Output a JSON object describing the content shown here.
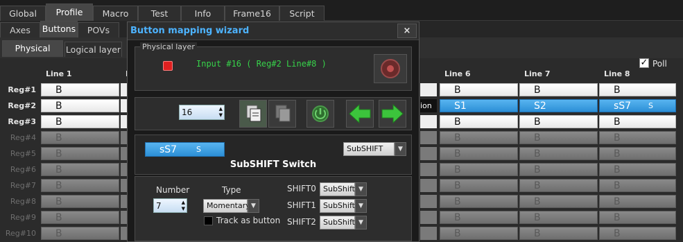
{
  "tabs": [
    "Global",
    "Profile",
    "Macro",
    "Test",
    "Info",
    "Frame16",
    "Script"
  ],
  "subtabs": [
    "Axes",
    "Buttons",
    "POVs"
  ],
  "layer_tabs": [
    "Physical layer",
    "Logical layer"
  ],
  "poll": {
    "label": "Poll",
    "checked": true,
    "checkmark": "✓"
  },
  "grid": {
    "columns": [
      "Line 1",
      "Line 6",
      "Line 7",
      "Line 8"
    ],
    "partial_col": "L",
    "rows": [
      "Reg#1",
      "Reg#2",
      "Reg#3",
      "Reg#4",
      "Reg#5",
      "Reg#6",
      "Reg#7",
      "Reg#8",
      "Reg#9",
      "Reg#10"
    ],
    "cells": [
      [
        "B",
        "B",
        "B",
        "B"
      ],
      [
        "B",
        "S1",
        "S2",
        "sS7"
      ],
      [
        "B",
        "B",
        "B",
        "B"
      ],
      [
        "B",
        "B",
        "B",
        "B"
      ],
      [
        "B",
        "B",
        "B",
        "B"
      ],
      [
        "B",
        "B",
        "B",
        "B"
      ],
      [
        "B",
        "B",
        "B",
        "B"
      ],
      [
        "B",
        "B",
        "B",
        "B"
      ],
      [
        "B",
        "B",
        "B",
        "B"
      ],
      [
        "B",
        "B",
        "B",
        "B"
      ]
    ],
    "reg2_line8_badge": "S",
    "partial_label": "ion"
  },
  "dialog": {
    "title": "Button mapping wizard",
    "close": "×",
    "physical": {
      "group_label": "Physical layer",
      "input_text": "Input #16  ( Reg#2  Line#8 )",
      "indicator_color": "#e02020"
    },
    "toolbar": {
      "input_number": "16"
    },
    "mapping": {
      "current_value": "sS7",
      "current_badge": "S",
      "func_type": "SubSHIFT",
      "title": "SubSHIFT Switch"
    },
    "params": {
      "number_label": "Number",
      "number_value": "7",
      "type_label": "Type",
      "type_value": "Momentary",
      "track_label": "Track as button",
      "shift0_label": "SHIFT0",
      "shift0_value": "SubShift",
      "shift1_label": "SHIFT1",
      "shift1_value": "SubShift",
      "shift2_label": "SHIFT2",
      "shift2_value": "SubShift"
    }
  },
  "colors": {
    "accent_blue": "#2c8fd6",
    "title_blue": "#4db3ff",
    "status_green": "#37d24a",
    "arrow_green": "#3cc43c"
  }
}
